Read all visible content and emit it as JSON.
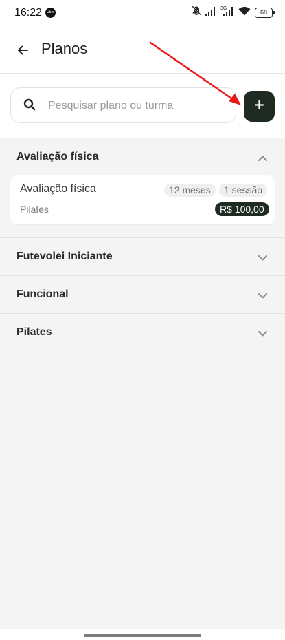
{
  "status_bar": {
    "time": "16:22",
    "app_badge": "Uber",
    "network": "3G",
    "battery": "68"
  },
  "header": {
    "title": "Planos"
  },
  "search": {
    "placeholder": "Pesquisar plano ou turma",
    "value": ""
  },
  "sections": [
    {
      "title": "Avaliação física",
      "expanded": true,
      "plans": [
        {
          "name": "Avaliação física",
          "category": "Pilates",
          "duration": "12 meses",
          "sessions": "1 sessão",
          "price": "R$ 100,00"
        }
      ]
    },
    {
      "title": "Futevolei Iniciante",
      "expanded": false
    },
    {
      "title": "Funcional",
      "expanded": false
    },
    {
      "title": "Pilates",
      "expanded": false
    }
  ],
  "colors": {
    "accent_dark": "#1f2a22",
    "background": "#f4f4f4",
    "annotation_arrow": "#e8191b"
  }
}
